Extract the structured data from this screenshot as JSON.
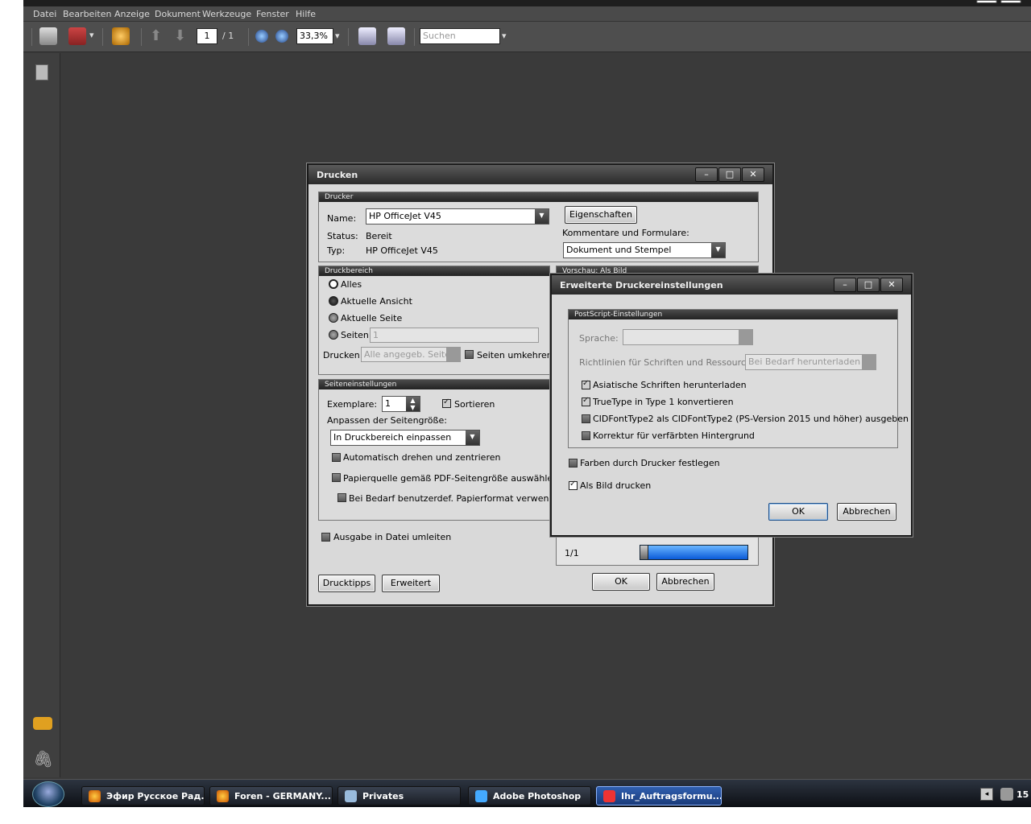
{
  "menu": [
    "Datei",
    "Bearbeiten",
    "Anzeige",
    "Dokument",
    "Werkzeuge",
    "Fenster",
    "Hilfe"
  ],
  "toolbar": {
    "page_current": "1",
    "page_total": "/ 1",
    "zoom": "33,3%",
    "search_placeholder": "Suchen"
  },
  "print_dialog": {
    "title": "Drucken",
    "printer_header": "Drucker",
    "name_label": "Name:",
    "name_value": "HP OfficeJet V45",
    "properties_btn": "Eigenschaften",
    "status_label": "Status:",
    "status_value": "Bereit",
    "type_label": "Typ:",
    "type_value": "HP OfficeJet V45",
    "comments_label": "Kommentare und Formulare:",
    "comments_value": "Dokument und Stempel",
    "range_header": "Druckbereich",
    "range_all": "Alles",
    "range_view": "Aktuelle Ansicht",
    "range_page": "Aktuelle Seite",
    "range_pages": "Seiten",
    "pages_value": "1",
    "print_label": "Drucken:",
    "print_value": "Alle angegeb. Seiten",
    "reverse_label": "Seiten umkehren",
    "preview_header": "Vorschau: Als Bild",
    "page_setup_header": "Seiteneinstellungen",
    "copies_label": "Exemplare:",
    "copies_value": "1",
    "collate_label": "Sortieren",
    "scaling_label": "Anpassen der Seitengröße:",
    "scaling_value": "In Druckbereich einpassen",
    "auto_rotate": "Automatisch drehen und zentrieren",
    "paper_source": "Papierquelle gemäß PDF-Seitengröße auswählen",
    "custom_paper": "Bei Bedarf benutzerdef. Papierformat verwenden",
    "print_to_file": "Ausgabe in Datei umleiten",
    "preview_page": "1/1",
    "tips_btn": "Drucktipps",
    "advanced_btn": "Erweitert",
    "ok_btn": "OK",
    "cancel_btn": "Abbrechen"
  },
  "advanced_dialog": {
    "title": "Erweiterte Druckereinstellungen",
    "ps_header": "PostScript-Einstellungen",
    "language_label": "Sprache:",
    "fonts_policy_label": "Richtlinien für Schriften und Ressourcen:",
    "fonts_policy_value": "Bei Bedarf herunterladen",
    "asian_fonts": "Asiatische Schriften herunterladen",
    "truetype": "TrueType in Type 1 konvertieren",
    "cidfont": "CIDFontType2 als CIDFontType2 (PS-Version 2015 und höher) ausgeben",
    "bg_correction": "Korrektur für verfärbten Hintergrund",
    "printer_colors": "Farben durch Drucker festlegen",
    "print_as_image": "Als Bild drucken",
    "ok_btn": "OK",
    "cancel_btn": "Abbrechen"
  },
  "taskbar": {
    "items": [
      "Эфир Русское Рад...",
      "Foren - GERMANY....",
      "Privates",
      "Adobe Photoshop",
      "Ihr_Auftragsformu..."
    ],
    "clock": "15"
  }
}
